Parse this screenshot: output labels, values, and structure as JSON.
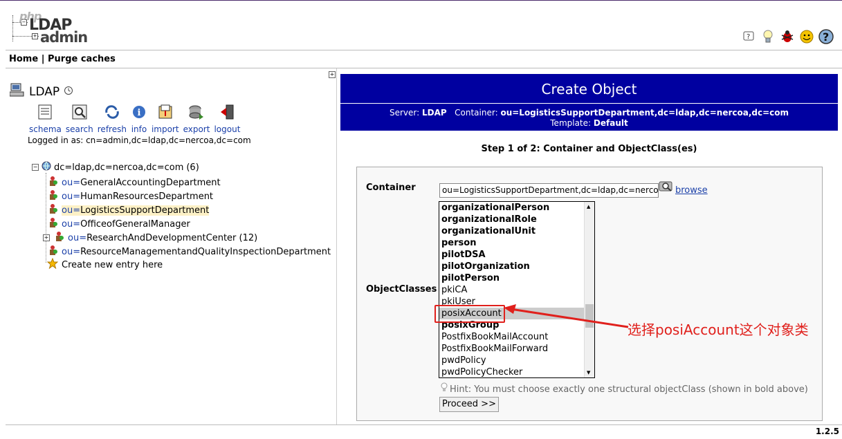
{
  "logo": {
    "php": "php",
    "ldap": "LDAP",
    "admin": "admin"
  },
  "menubar": {
    "home": "Home",
    "separator": " | ",
    "purge": "Purge caches"
  },
  "server": {
    "name": "LDAP"
  },
  "actions": [
    {
      "label": "schema",
      "icon": "schema-icon"
    },
    {
      "label": "search",
      "icon": "search-icon"
    },
    {
      "label": "refresh",
      "icon": "refresh-icon"
    },
    {
      "label": "info",
      "icon": "info-icon"
    },
    {
      "label": "import",
      "icon": "import-icon"
    },
    {
      "label": "export",
      "icon": "export-icon"
    },
    {
      "label": "logout",
      "icon": "logout-icon"
    }
  ],
  "logged_in": "Logged in as: cn=admin,dc=ldap,dc=nercoa,dc=com",
  "tree": {
    "root": {
      "label": "dc=ldap,dc=nercoa,dc=com",
      "count": "(6)"
    },
    "nodes": [
      {
        "prefix": "ou=",
        "name": "GeneralAccountingDepartment",
        "count": ""
      },
      {
        "prefix": "ou=",
        "name": "HumanResourcesDepartment",
        "count": ""
      },
      {
        "prefix": "ou=",
        "name": "LogisticsSupportDepartment",
        "count": ""
      },
      {
        "prefix": "ou=",
        "name": "OfficeofGeneralManager",
        "count": ""
      },
      {
        "prefix": "ou=",
        "name": "ResearchAndDevelopmentCenter",
        "count": "(12)"
      },
      {
        "prefix": "ou=",
        "name": "ResourceManagementandQualityInspectionDepartment",
        "count": ""
      }
    ],
    "create": "Create new entry here"
  },
  "header": {
    "title": "Create Object",
    "server_label": "Server:",
    "server_value": "LDAP",
    "container_label": "Container:",
    "container_value": "ou=LogisticsSupportDepartment,dc=ldap,dc=nercoa,dc=com",
    "template_label": "Template:",
    "template_value": "Default"
  },
  "step": "Step 1 of 2: Container and ObjectClass(es)",
  "form": {
    "container_label": "Container",
    "container_value": "ou=LogisticsSupportDepartment,dc=ldap,dc=nercoa",
    "browse": "browse",
    "objectclasses_label": "ObjectClasses",
    "options": [
      {
        "label": "organizationalPerson",
        "bold": true
      },
      {
        "label": "organizationalRole",
        "bold": true
      },
      {
        "label": "organizationalUnit",
        "bold": true
      },
      {
        "label": "person",
        "bold": true
      },
      {
        "label": "pilotDSA",
        "bold": true
      },
      {
        "label": "pilotOrganization",
        "bold": true
      },
      {
        "label": "pilotPerson",
        "bold": true
      },
      {
        "label": "pkiCA",
        "bold": false
      },
      {
        "label": "pkiUser",
        "bold": false
      },
      {
        "label": "posixAccount",
        "bold": false,
        "selected": true
      },
      {
        "label": "posixGroup",
        "bold": true
      },
      {
        "label": "PostfixBookMailAccount",
        "bold": false
      },
      {
        "label": "PostfixBookMailForward",
        "bold": false
      },
      {
        "label": "pwdPolicy",
        "bold": false
      },
      {
        "label": "pwdPolicyChecker",
        "bold": false
      }
    ],
    "hint": "Hint: You must choose exactly one structural objectClass (shown in bold above)",
    "proceed": "Proceed >>"
  },
  "annotation": "选择posiAccount这个对象类",
  "version": "1.2.5",
  "colors": {
    "header_bg": "#0000a0",
    "link": "#1a3fa8",
    "annotation": "#e0201c",
    "highlight": "#fdf1c6"
  }
}
